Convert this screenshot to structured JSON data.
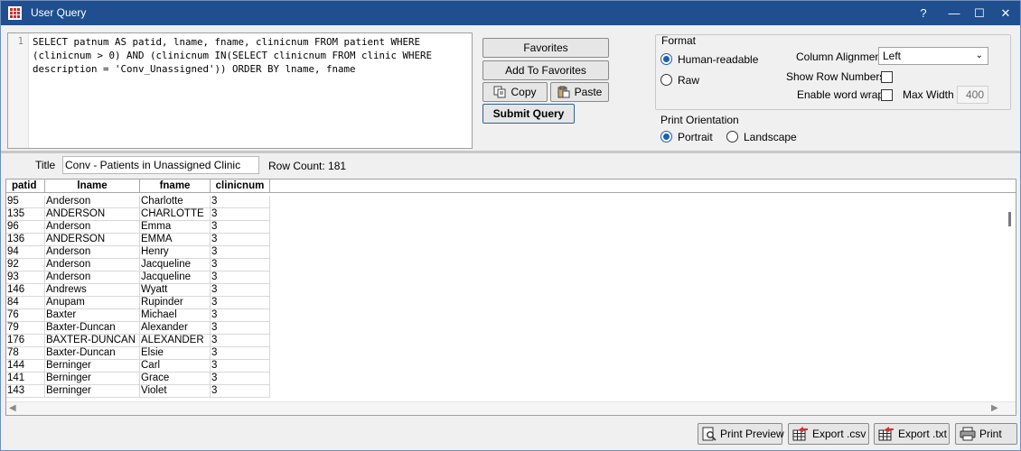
{
  "window": {
    "title": "User Query",
    "controls": [
      "?",
      "—",
      "☐",
      "✕"
    ]
  },
  "editor": {
    "line_number": "1",
    "query": "SELECT patnum AS patid, lname, fname, clinicnum FROM patient WHERE (clinicnum > 0) AND (clinicnum IN(SELECT clinicnum FROM clinic WHERE description = 'Conv_Unassigned')) ORDER BY lname, fname"
  },
  "buttons": {
    "favorites": "Favorites",
    "add_to_favorites": "Add To Favorites",
    "copy": "Copy",
    "paste": "Paste",
    "submit_query": "Submit Query"
  },
  "format": {
    "group_label": "Format",
    "human_readable": "Human-readable",
    "raw": "Raw",
    "selected": "human_readable",
    "column_alignment_label": "Column Alignment",
    "column_alignment_value": "Left",
    "show_row_numbers_label": "Show Row Numbers",
    "show_row_numbers": false,
    "enable_word_wrap_label": "Enable word wrap",
    "enable_word_wrap": false,
    "max_width_label": "Max Width",
    "max_width_value": "400"
  },
  "print_orientation": {
    "label": "Print Orientation",
    "portrait": "Portrait",
    "landscape": "Landscape",
    "selected": "portrait"
  },
  "results": {
    "title_label": "Title",
    "title_value": "Conv - Patients in Unassigned Clinic",
    "row_count": "Row Count: 181",
    "columns": [
      "patid",
      "lname",
      "fname",
      "clinicnum"
    ],
    "rows": [
      [
        "95",
        "Anderson",
        "Charlotte",
        "3"
      ],
      [
        "135",
        "ANDERSON",
        "CHARLOTTE",
        "3"
      ],
      [
        "96",
        "Anderson",
        "Emma",
        "3"
      ],
      [
        "136",
        "ANDERSON",
        "EMMA",
        "3"
      ],
      [
        "94",
        "Anderson",
        "Henry",
        "3"
      ],
      [
        "92",
        "Anderson",
        "Jacqueline",
        "3"
      ],
      [
        "93",
        "Anderson",
        "Jacqueline",
        "3"
      ],
      [
        "146",
        "Andrews",
        "Wyatt",
        "3"
      ],
      [
        "84",
        "Anupam",
        "Rupinder",
        "3"
      ],
      [
        "76",
        "Baxter",
        "Michael",
        "3"
      ],
      [
        "79",
        "Baxter-Duncan",
        "Alexander",
        "3"
      ],
      [
        "176",
        "BAXTER-DUNCAN",
        "ALEXANDER",
        "3"
      ],
      [
        "78",
        "Baxter-Duncan",
        "Elsie",
        "3"
      ],
      [
        "144",
        "Berninger",
        "Carl",
        "3"
      ],
      [
        "141",
        "Berninger",
        "Grace",
        "3"
      ],
      [
        "143",
        "Berninger",
        "Violet",
        "3"
      ]
    ]
  },
  "bottom_buttons": {
    "print_preview": "Print Preview",
    "export_csv": "Export .csv",
    "export_txt": "Export .txt",
    "print": "Print"
  },
  "colors": {
    "titlebar": "#1f4f8f",
    "accent": "#1a5fb4",
    "export_icon_red": "#d32f2f"
  }
}
